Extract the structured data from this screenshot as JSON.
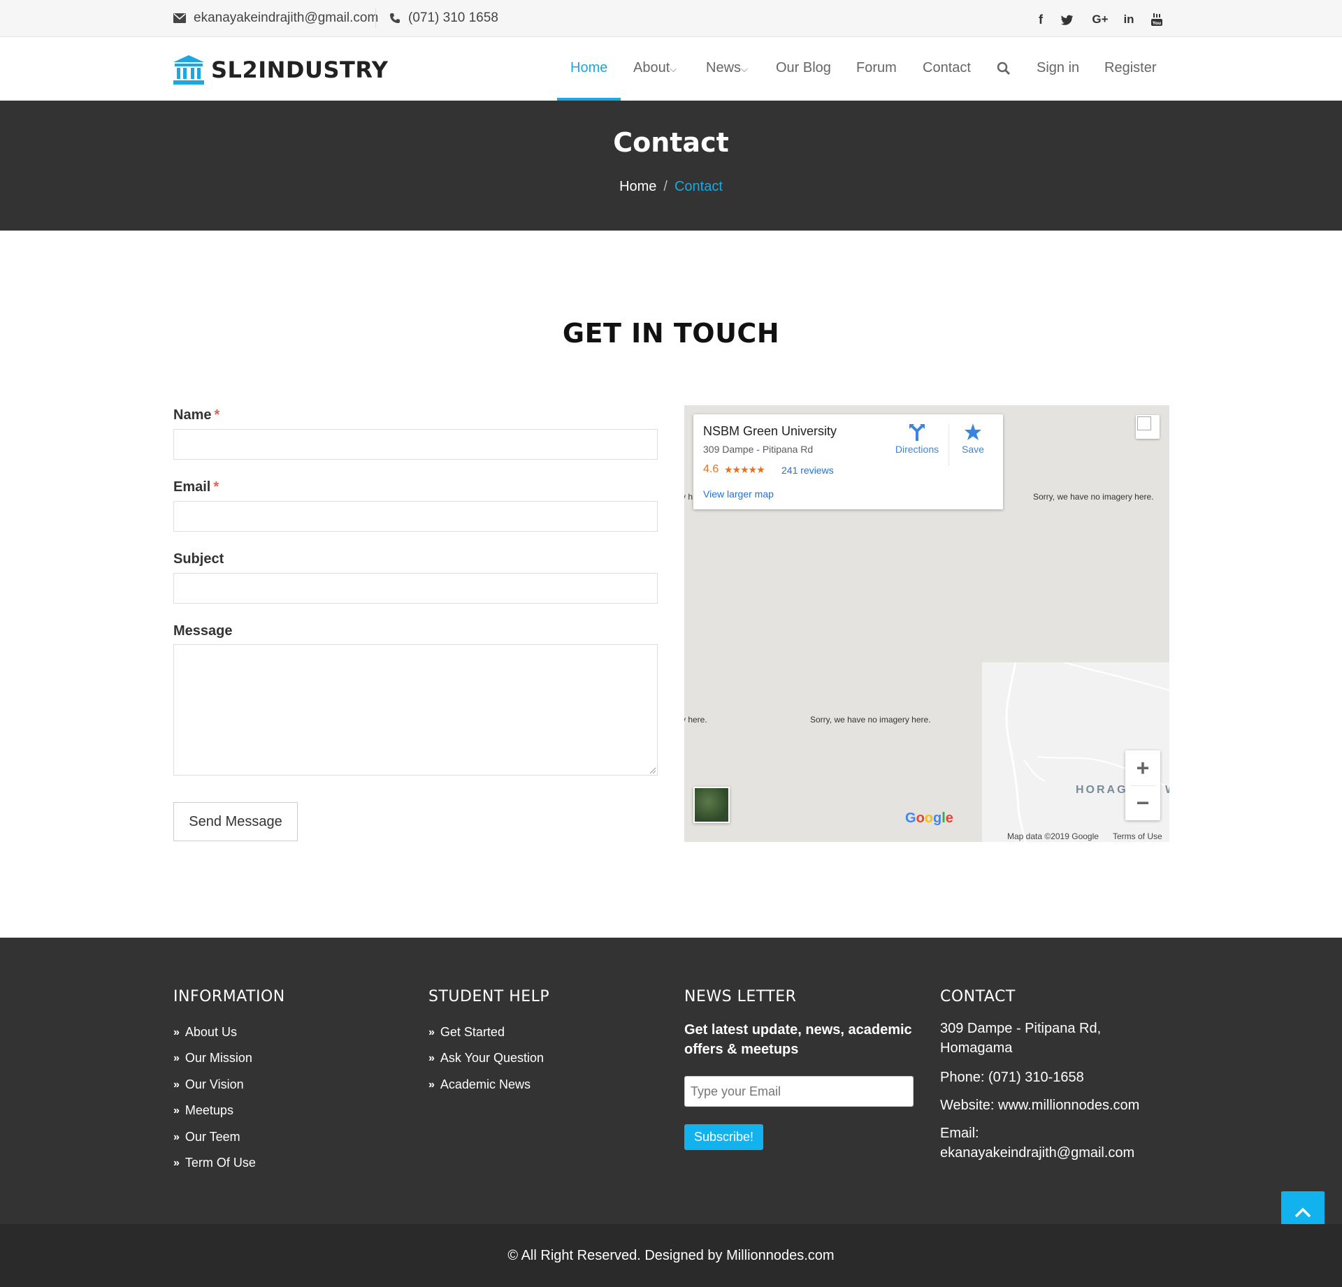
{
  "topbar": {
    "email": "ekanayakeindrajith@gmail.com",
    "phone": "(071) 310 1658",
    "social": [
      "facebook-icon",
      "twitter-icon",
      "google-plus-icon",
      "linkedin-icon",
      "youtube-icon"
    ]
  },
  "header": {
    "logo": "SL2INDUSTRY",
    "nav": {
      "home": "Home",
      "about": "About",
      "news": "News",
      "blog": "Our Blog",
      "forum": "Forum",
      "contact": "Contact",
      "signin": "Sign in",
      "register": "Register"
    }
  },
  "banner": {
    "title": "Contact",
    "breadcrumb_home": "Home",
    "breadcrumb_sep": "/",
    "breadcrumb_current": "Contact"
  },
  "form": {
    "title": "GET IN TOUCH",
    "name_label": "Name",
    "email_label": "Email",
    "subject_label": "Subject",
    "message_label": "Message",
    "required_mark": "*",
    "name_value": "",
    "email_value": "",
    "subject_value": "",
    "message_value": "",
    "send_label": "Send Message"
  },
  "map": {
    "place_name": "NSBM Green University",
    "address": "309 Dampe - Pitipana Rd",
    "rating": "4.6",
    "stars": "★★★★★",
    "reviews": "241 reviews",
    "larger_map": "View larger map",
    "directions": "Directions",
    "save": "Save",
    "no_imagery": "Sorry, we have no imagery here.",
    "no_imagery_partial": "y here.",
    "no_imagery_partial_top": "y h",
    "area_label": "HORAG",
    "area_label_tail": "W",
    "google": "Google",
    "map_data": "Map data ©2019 Google",
    "terms": "Terms of Use",
    "zoom_in": "+",
    "zoom_out": "−"
  },
  "footer": {
    "information": {
      "title": "INFORMATION",
      "links": [
        "About Us",
        "Our Mission",
        "Our Vision",
        "Meetups",
        "Our Teem",
        "Term Of Use"
      ]
    },
    "student_help": {
      "title": "STUDENT HELP",
      "links": [
        "Get Started",
        "Ask Your Question",
        "Academic News"
      ]
    },
    "newsletter": {
      "title": "NEWS LETTER",
      "text": "Get latest update, news, academic offers & meetups",
      "placeholder": "Type your Email",
      "button": "Subscribe!"
    },
    "contact": {
      "title": "CONTACT",
      "address": "309 Dampe - Pitipana Rd, Homagama",
      "phone": "Phone: (071) 310-1658",
      "website": "Website: www.millionnodes.com",
      "email": "Email: ekanayakeindrajith@gmail.com"
    }
  },
  "copyright": "© All Right Reserved. Designed by Millionnodes.com",
  "colors": {
    "accent": "#1ba8e0",
    "dark": "#333333",
    "darker": "#2a2a2a",
    "required": "#e8604c"
  }
}
